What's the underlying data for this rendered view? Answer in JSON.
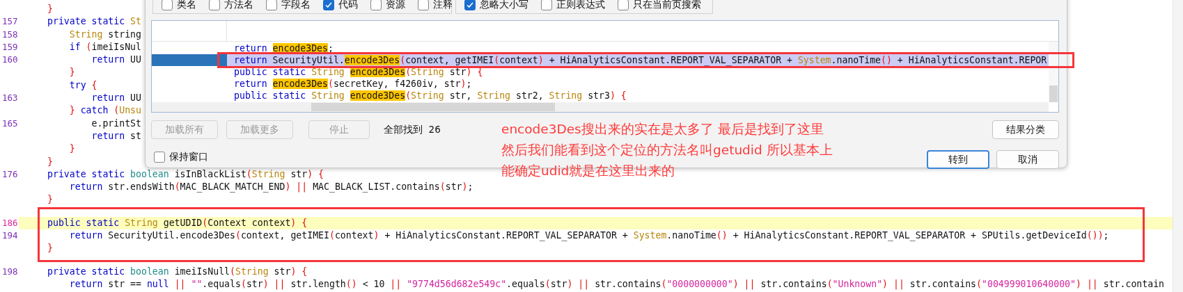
{
  "editor": {
    "lines": [
      {
        "kind": "code",
        "highlighted": false,
        "tokens": [
          {
            "kind": "punct",
            "text": "}"
          }
        ]
      },
      {
        "kind": "code",
        "number": "157",
        "highlighted": false,
        "tokens": [
          {
            "kind": "kw",
            "text": "private static "
          },
          {
            "kind": "type",
            "text": "St"
          }
        ]
      },
      {
        "kind": "code",
        "number": "158",
        "highlighted": false,
        "tokens": [
          {
            "kind": "type",
            "text": "    String"
          },
          {
            "kind": "plain",
            "text": " string"
          }
        ]
      },
      {
        "kind": "code",
        "number": "159",
        "highlighted": false,
        "tokens": [
          {
            "kind": "kw",
            "text": "    if "
          },
          {
            "kind": "punct",
            "text": "("
          },
          {
            "kind": "plain",
            "text": "imeiIsNul"
          }
        ]
      },
      {
        "kind": "code",
        "number": "160",
        "highlighted": false,
        "tokens": [
          {
            "kind": "kw",
            "text": "        return "
          },
          {
            "kind": "plain",
            "text": "UU"
          }
        ]
      },
      {
        "kind": "code",
        "highlighted": false,
        "tokens": [
          {
            "kind": "punct",
            "text": "    }"
          }
        ]
      },
      {
        "kind": "code",
        "highlighted": false,
        "tokens": [
          {
            "kind": "kw",
            "text": "    try "
          },
          {
            "kind": "punct",
            "text": "{"
          }
        ]
      },
      {
        "kind": "code",
        "number": "163",
        "highlighted": false,
        "tokens": [
          {
            "kind": "kw",
            "text": "        return "
          },
          {
            "kind": "plain",
            "text": "UU"
          }
        ]
      },
      {
        "kind": "code",
        "highlighted": false,
        "tokens": [
          {
            "kind": "punct",
            "text": "    } "
          },
          {
            "kind": "kw",
            "text": "catch "
          },
          {
            "kind": "punct",
            "text": "("
          },
          {
            "kind": "type",
            "text": "Unsu"
          }
        ]
      },
      {
        "kind": "code",
        "number": "165",
        "highlighted": false,
        "tokens": [
          {
            "kind": "plain",
            "text": "        e.printSt"
          }
        ]
      },
      {
        "kind": "code",
        "highlighted": false,
        "tokens": [
          {
            "kind": "kw",
            "text": "        return "
          },
          {
            "kind": "plain",
            "text": "st"
          }
        ]
      },
      {
        "kind": "code",
        "highlighted": false,
        "tokens": [
          {
            "kind": "punct",
            "text": "    }"
          }
        ]
      },
      {
        "kind": "code",
        "highlighted": false,
        "tokens": [
          {
            "kind": "punct",
            "text": "}"
          }
        ]
      },
      {
        "kind": "code",
        "number": "176",
        "highlighted": false,
        "tokens": [
          {
            "kind": "kw",
            "text": "private static "
          },
          {
            "kind": "prim",
            "text": "boolean "
          },
          {
            "kind": "plain",
            "text": "isInBlackList"
          },
          {
            "kind": "punct",
            "text": "("
          },
          {
            "kind": "type",
            "text": "String "
          },
          {
            "kind": "plain",
            "text": "str"
          },
          {
            "kind": "punct",
            "text": ") {"
          }
        ]
      },
      {
        "kind": "code",
        "highlighted": false,
        "tokens": [
          {
            "kind": "kw",
            "text": "    return "
          },
          {
            "kind": "plain",
            "text": "str.endsWith"
          },
          {
            "kind": "punct",
            "text": "("
          },
          {
            "kind": "plain",
            "text": "MAC_BLACK_MATCH_END"
          },
          {
            "kind": "punct",
            "text": ") || "
          },
          {
            "kind": "plain",
            "text": "MAC_BLACK_LIST.contains"
          },
          {
            "kind": "punct",
            "text": "("
          },
          {
            "kind": "plain",
            "text": "str"
          },
          {
            "kind": "punct",
            "text": ")"
          },
          {
            "kind": "plain",
            "text": ";"
          }
        ]
      },
      {
        "kind": "code",
        "highlighted": false,
        "tokens": [
          {
            "kind": "punct",
            "text": "}"
          }
        ]
      },
      {
        "kind": "gap"
      },
      {
        "kind": "code",
        "number": "186",
        "highlighted": true,
        "tokens": [
          {
            "kind": "kw",
            "text": "public static "
          },
          {
            "kind": "type",
            "text": "String "
          },
          {
            "kind": "plain",
            "text": "getUDID"
          },
          {
            "kind": "punct",
            "text": "("
          },
          {
            "kind": "plain",
            "text": "Context context"
          },
          {
            "kind": "punct",
            "text": ") {"
          }
        ]
      },
      {
        "kind": "code",
        "number": "194",
        "highlighted": false,
        "tokens": [
          {
            "kind": "kw",
            "text": "    return "
          },
          {
            "kind": "plain",
            "text": "SecurityUtil.encode3Des"
          },
          {
            "kind": "punct",
            "text": "("
          },
          {
            "kind": "plain",
            "text": "context, getIMEI"
          },
          {
            "kind": "punct",
            "text": "("
          },
          {
            "kind": "plain",
            "text": "context"
          },
          {
            "kind": "punct",
            "text": ")"
          },
          {
            "kind": "plain",
            "text": " + HiAnalyticsConstant.REPORT_VAL_SEPARATOR + "
          },
          {
            "kind": "type",
            "text": "System"
          },
          {
            "kind": "plain",
            "text": ".nanoTime"
          },
          {
            "kind": "punct",
            "text": "()"
          },
          {
            "kind": "plain",
            "text": " + HiAnalyticsConstant.REPORT_VAL_SEPARATOR + SPUtils.getDeviceId"
          },
          {
            "kind": "punct",
            "text": "())"
          },
          {
            "kind": "plain",
            "text": ";"
          }
        ]
      },
      {
        "kind": "code",
        "highlighted": false,
        "tokens": [
          {
            "kind": "punct",
            "text": "}"
          }
        ]
      },
      {
        "kind": "gap"
      },
      {
        "kind": "code",
        "number": "198",
        "highlighted": false,
        "tokens": [
          {
            "kind": "kw",
            "text": "private static "
          },
          {
            "kind": "prim",
            "text": "boolean "
          },
          {
            "kind": "plain",
            "text": "imeiIsNull"
          },
          {
            "kind": "punct",
            "text": "("
          },
          {
            "kind": "type",
            "text": "String "
          },
          {
            "kind": "plain",
            "text": "str"
          },
          {
            "kind": "punct",
            "text": ") {"
          }
        ]
      },
      {
        "kind": "code",
        "highlighted": false,
        "tokens": [
          {
            "kind": "kw",
            "text": "    return "
          },
          {
            "kind": "plain",
            "text": "str == "
          },
          {
            "kind": "kw",
            "text": "null "
          },
          {
            "kind": "punct",
            "text": "|| "
          },
          {
            "kind": "str",
            "text": "\"\""
          },
          {
            "kind": "plain",
            "text": ".equals"
          },
          {
            "kind": "punct",
            "text": "("
          },
          {
            "kind": "plain",
            "text": "str"
          },
          {
            "kind": "punct",
            "text": ") || "
          },
          {
            "kind": "plain",
            "text": "str.length"
          },
          {
            "kind": "punct",
            "text": "()"
          },
          {
            "kind": "plain",
            "text": " < 10 "
          },
          {
            "kind": "punct",
            "text": "|| "
          },
          {
            "kind": "str",
            "text": "\"9774d56d682e549c\""
          },
          {
            "kind": "plain",
            "text": ".equals"
          },
          {
            "kind": "punct",
            "text": "("
          },
          {
            "kind": "plain",
            "text": "str"
          },
          {
            "kind": "punct",
            "text": ") || "
          },
          {
            "kind": "plain",
            "text": "str.contains"
          },
          {
            "kind": "punct",
            "text": "("
          },
          {
            "kind": "str",
            "text": "\"0000000000\""
          },
          {
            "kind": "punct",
            "text": ") || "
          },
          {
            "kind": "plain",
            "text": "str.contains"
          },
          {
            "kind": "punct",
            "text": "("
          },
          {
            "kind": "str",
            "text": "\"Unknown\""
          },
          {
            "kind": "punct",
            "text": ") || "
          },
          {
            "kind": "plain",
            "text": "str.contains"
          },
          {
            "kind": "punct",
            "text": "("
          },
          {
            "kind": "str",
            "text": "\"004999010640000\""
          },
          {
            "kind": "punct",
            "text": ") || "
          },
          {
            "kind": "plain",
            "text": "str.contain"
          }
        ]
      }
    ]
  },
  "search_dialog": {
    "filters": [
      {
        "label": "类名",
        "checked": false
      },
      {
        "label": "方法名",
        "checked": false
      },
      {
        "label": "字段名",
        "checked": false
      },
      {
        "label": "代码",
        "checked": true
      },
      {
        "label": "资源",
        "checked": false
      },
      {
        "label": "注释",
        "checked": false
      }
    ],
    "options": [
      {
        "label": "忽略大小写",
        "checked": true
      },
      {
        "label": "正则表达式",
        "checked": false
      },
      {
        "label": "只在当前页搜索",
        "checked": false
      }
    ],
    "results": [
      {
        "selected": false,
        "tokens": [
          {
            "kind": "kw",
            "text": "return "
          },
          {
            "kind": "match",
            "text": "encode3Des"
          },
          {
            "kind": "plain",
            "text": ";"
          }
        ]
      },
      {
        "selected": true,
        "tokens": [
          {
            "kind": "kw",
            "text": "return "
          },
          {
            "kind": "plain",
            "text": "SecurityUtil."
          },
          {
            "kind": "match",
            "text": "encode3Des"
          },
          {
            "kind": "punct",
            "text": "("
          },
          {
            "kind": "plain",
            "text": "context, getIMEI"
          },
          {
            "kind": "punct",
            "text": "("
          },
          {
            "kind": "plain",
            "text": "context"
          },
          {
            "kind": "punct",
            "text": ")"
          },
          {
            "kind": "plain",
            "text": " + HiAnalyticsConstant.REPORT_VAL_SEPARATOR + "
          },
          {
            "kind": "type",
            "text": "System"
          },
          {
            "kind": "plain",
            "text": ".nanoTime"
          },
          {
            "kind": "punct",
            "text": "()"
          },
          {
            "kind": "plain",
            "text": " + HiAnalyticsConstant.REPOR"
          }
        ]
      },
      {
        "selected": false,
        "tokens": [
          {
            "kind": "kw",
            "text": "public static "
          },
          {
            "kind": "type",
            "text": "String "
          },
          {
            "kind": "match",
            "text": "encode3Des"
          },
          {
            "kind": "punct",
            "text": "("
          },
          {
            "kind": "type",
            "text": "String "
          },
          {
            "kind": "plain",
            "text": "str"
          },
          {
            "kind": "punct",
            "text": ") {"
          }
        ]
      },
      {
        "selected": false,
        "tokens": [
          {
            "kind": "kw",
            "text": "return "
          },
          {
            "kind": "match",
            "text": "encode3Des"
          },
          {
            "kind": "punct",
            "text": "("
          },
          {
            "kind": "plain",
            "text": "secretKey, f4260iv, str"
          },
          {
            "kind": "punct",
            "text": ")"
          },
          {
            "kind": "plain",
            "text": ";"
          }
        ]
      },
      {
        "selected": false,
        "tokens": [
          {
            "kind": "kw",
            "text": "public static "
          },
          {
            "kind": "type",
            "text": "String "
          },
          {
            "kind": "match",
            "text": "encode3Des"
          },
          {
            "kind": "punct",
            "text": "("
          },
          {
            "kind": "type",
            "text": "String "
          },
          {
            "kind": "plain",
            "text": "str, "
          },
          {
            "kind": "type",
            "text": "String "
          },
          {
            "kind": "plain",
            "text": "str2, "
          },
          {
            "kind": "type",
            "text": "String "
          },
          {
            "kind": "plain",
            "text": "str3"
          },
          {
            "kind": "punct",
            "text": ") {"
          }
        ]
      }
    ],
    "load_buttons": [
      {
        "label": "加载所有",
        "disabled": true
      },
      {
        "label": "加载更多",
        "disabled": true
      },
      {
        "label": "停止",
        "disabled": true
      }
    ],
    "found_text": "全部找到  26",
    "keep_window": {
      "label": "保持窗口",
      "checked": false
    },
    "categorize_button": "结果分类",
    "go_button": "转到",
    "cancel_button": "取消"
  },
  "annotation": {
    "lines": [
      "encode3Des搜出来的实在是太多了  最后是找到了这里",
      "然后我们能看到这个定位的方法名叫getudid 所以基本上",
      "能确定udid就是在这里出来的"
    ]
  }
}
